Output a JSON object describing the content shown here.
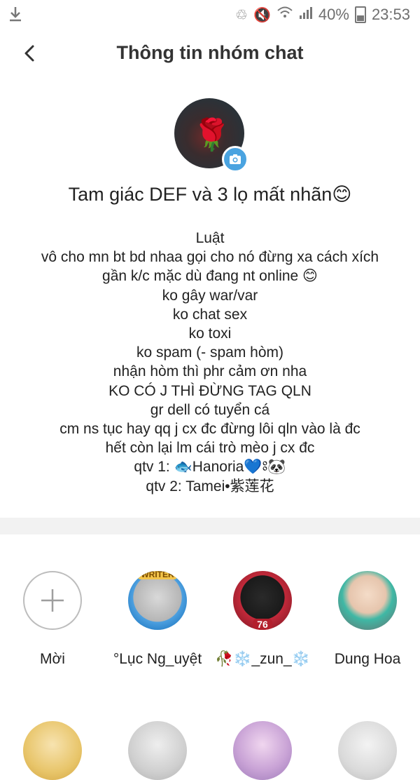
{
  "status_bar": {
    "download_icon": "download-arrow-icon",
    "battery": "40%",
    "time": "23:53"
  },
  "header": {
    "title": "Thông tin nhóm chat"
  },
  "group": {
    "name": "Tam giác DEF và 3 lọ mất nhãn😊"
  },
  "rules": {
    "lines": [
      "Luật",
      "vô cho mn bt bd nhaa gọi cho nó đừng xa cách xích",
      "gần k/c mặc dù đang nt online 😊",
      "ko gây war/var",
      "ko chat sex",
      "ko toxi",
      "ko spam (- spam hòm)",
      "nhận hòm thì phr cảm ơn nha",
      "KO CÓ J THÌ ĐỪNG TAG QLN",
      "gr dell có tuyển cá",
      "cm ns tục hay  qq j cx đc đừng lôi qln vào là đc",
      "hết còn lại lm cái trò mèo j cx đc",
      "qtv 1: 🐟Hanoria💙ཿ🐼",
      "qtv 2:  Tamei•紫莲花"
    ]
  },
  "members": {
    "invite_label": "Mời",
    "items": [
      {
        "name": "°Lục Ng_uyệt",
        "badge": "WRITER"
      },
      {
        "name": "🥀❄️_zun_❄️",
        "badge": "76"
      },
      {
        "name": "Dung Hoa"
      }
    ]
  },
  "colors": {
    "camera_badge": "#4aa3e0",
    "divider": "#f2f2f2"
  }
}
